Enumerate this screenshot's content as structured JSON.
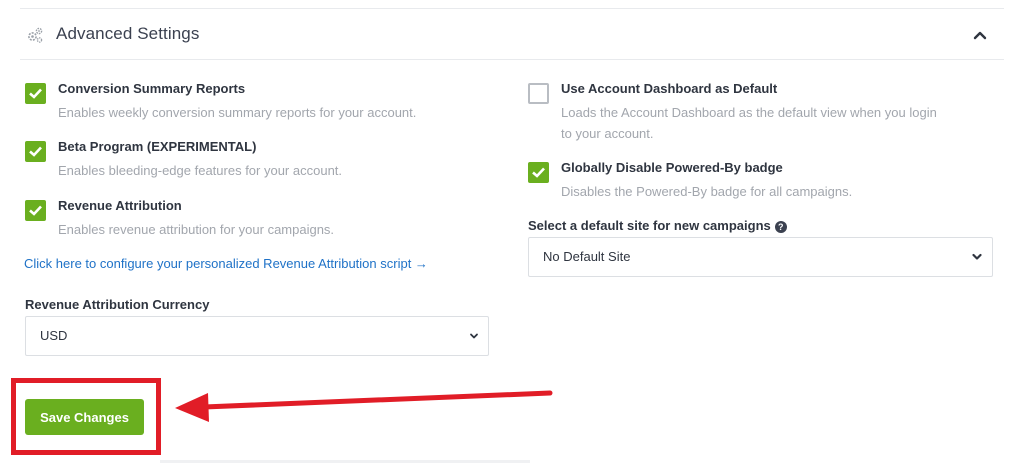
{
  "header": {
    "title": "Advanced Settings",
    "settings_icon": "gears-icon",
    "collapse_icon": "chevron-up-icon"
  },
  "left_options": [
    {
      "label": "Conversion Summary Reports",
      "description": "Enables weekly conversion summary reports for your account.",
      "checked": true
    },
    {
      "label": "Beta Program (EXPERIMENTAL)",
      "description": "Enables bleeding-edge features for your account.",
      "checked": true
    },
    {
      "label": "Revenue Attribution",
      "description": "Enables revenue attribution for your campaigns.",
      "checked": true
    }
  ],
  "right_options": [
    {
      "label": "Use Account Dashboard as Default",
      "description": "Loads the Account Dashboard as the default view when you login to your account.",
      "checked": false
    },
    {
      "label": "Globally Disable Powered-By badge",
      "description": "Disables the Powered-By badge for all campaigns.",
      "checked": true
    }
  ],
  "revenue_link": "Click here to configure your personalized Revenue Attribution script →",
  "currency": {
    "label": "Revenue Attribution Currency",
    "selected": "USD"
  },
  "default_site": {
    "label": "Select a default site for new campaigns",
    "help_glyph": "?",
    "selected": "No Default Site"
  },
  "save_label": "Save Changes",
  "colors": {
    "accent": "#6aaf1f",
    "link": "#1f72c7",
    "annotation": "#e11d27"
  }
}
